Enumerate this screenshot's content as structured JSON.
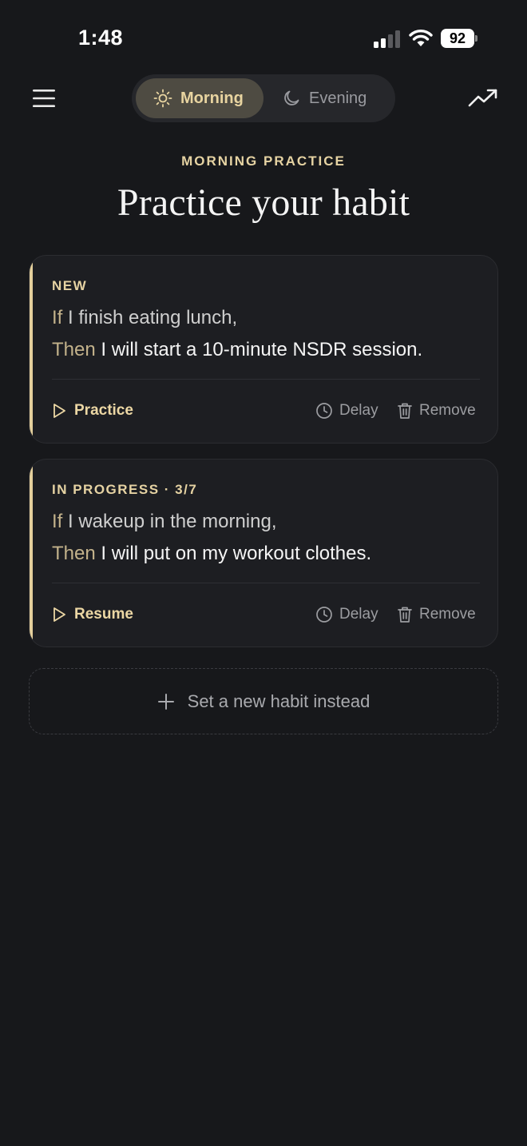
{
  "status_bar": {
    "time": "1:48",
    "battery_level": "92"
  },
  "header": {
    "tabs": [
      {
        "label": "Morning",
        "icon": "sun-icon",
        "selected": true
      },
      {
        "label": "Evening",
        "icon": "moon-icon",
        "selected": false
      }
    ]
  },
  "main": {
    "eyebrow": "MORNING PRACTICE",
    "title": "Practice your habit",
    "cards": [
      {
        "status": "NEW",
        "if_keyword": "If",
        "if_text": " I finish eating lunch,",
        "then_keyword": "Then",
        "then_text": " I will start a 10-minute NSDR session.",
        "primary_action": "Practice",
        "delay_label": "Delay",
        "remove_label": "Remove"
      },
      {
        "status": "IN PROGRESS · 3/7",
        "if_keyword": "If",
        "if_text": " I wakeup in the morning,",
        "then_keyword": "Then",
        "then_text": " I will put on my workout clothes.",
        "primary_action": "Resume",
        "delay_label": "Delay",
        "remove_label": "Remove"
      }
    ],
    "new_habit_label": "Set a new habit instead"
  },
  "colors": {
    "background": "#17181b",
    "accent": "#e6d3a3",
    "card": "#1d1e22"
  }
}
